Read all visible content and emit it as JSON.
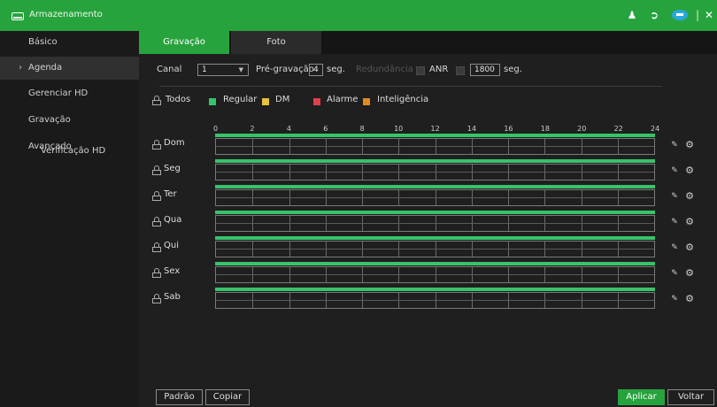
{
  "window": {
    "title": "Armazenamento"
  },
  "sidebar": {
    "items": [
      {
        "label": "Básico"
      },
      {
        "label": "Agenda"
      },
      {
        "label": "Gerenciar HD"
      },
      {
        "label": "Gravação"
      },
      {
        "label": "Avançado"
      },
      {
        "label": "Verificação HD"
      }
    ],
    "active_index": 1
  },
  "tabs": [
    {
      "label": "Gravação"
    },
    {
      "label": "Foto"
    }
  ],
  "settings": {
    "canal_label": "Canal",
    "canal_value": "1",
    "prerecord_label": "Pré-gravação",
    "prerecord_value": "4",
    "prerecord_unit": "seg.",
    "redundancy_label": "Redundância",
    "anr_label": "ANR",
    "anr_value": "1800",
    "anr_unit": "seg."
  },
  "legend": {
    "all_label": "Todos",
    "items": [
      {
        "label": "Regular",
        "color": "#37c36a"
      },
      {
        "label": "DM",
        "color": "#e8c23b"
      },
      {
        "label": "Alarme",
        "color": "#e0404a"
      },
      {
        "label": "Inteligência",
        "color": "#e38b1e"
      }
    ]
  },
  "schedule": {
    "hours": [
      "0",
      "2",
      "4",
      "6",
      "8",
      "10",
      "12",
      "14",
      "16",
      "18",
      "20",
      "22",
      "24"
    ],
    "days": [
      {
        "label": "Dom",
        "regular_start_h": 0,
        "regular_end_h": 24
      },
      {
        "label": "Seg",
        "regular_start_h": 0,
        "regular_end_h": 24
      },
      {
        "label": "Ter",
        "regular_start_h": 0,
        "regular_end_h": 24
      },
      {
        "label": "Qua",
        "regular_start_h": 0,
        "regular_end_h": 24
      },
      {
        "label": "Qui",
        "regular_start_h": 0,
        "regular_end_h": 24
      },
      {
        "label": "Sex",
        "regular_start_h": 0,
        "regular_end_h": 24
      },
      {
        "label": "Sab",
        "regular_start_h": 0,
        "regular_end_h": 24
      }
    ]
  },
  "footer": {
    "default_label": "Padrão",
    "copy_label": "Copiar",
    "apply_label": "Aplicar",
    "back_label": "Voltar"
  },
  "colors": {
    "accent": "#27a33d",
    "regular": "#37c36a"
  }
}
